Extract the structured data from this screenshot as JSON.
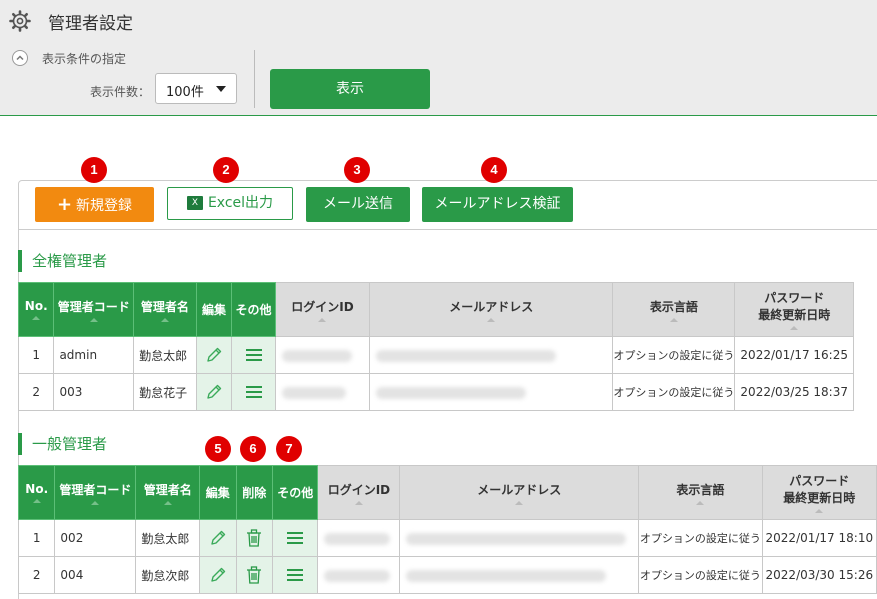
{
  "header": {
    "title": "管理者設定",
    "icon": "gear-icon"
  },
  "filter": {
    "section_label": "表示条件の指定",
    "count_label": "表示件数：",
    "count_value": "100件",
    "show_button": "表示"
  },
  "toolbar": {
    "new_label": "新規登録",
    "excel_label": "Excel出力",
    "mail_label": "メール送信",
    "verify_label": "メールアドレス検証"
  },
  "badges": [
    "1",
    "2",
    "3",
    "4",
    "5",
    "6",
    "7"
  ],
  "full_admins": {
    "title": "全権管理者",
    "headers": {
      "no": "No.",
      "code": "管理者コード",
      "name": "管理者名",
      "edit": "編集",
      "other": "その他",
      "login": "ログインID",
      "email": "メールアドレス",
      "lang": "表示言語",
      "pw1": "パスワード",
      "pw2": "最終更新日時"
    },
    "rows": [
      {
        "no": "1",
        "code": "admin",
        "name": "勤怠太郎",
        "lang": "オプションの設定に従う",
        "updated": "2022/01/17 16:25"
      },
      {
        "no": "2",
        "code": "003",
        "name": "勤怠花子",
        "lang": "オプションの設定に従う",
        "updated": "2022/03/25 18:37"
      }
    ]
  },
  "general_admins": {
    "title": "一般管理者",
    "headers": {
      "no": "No.",
      "code": "管理者コード",
      "name": "管理者名",
      "edit": "編集",
      "delete": "削除",
      "other": "その他",
      "login": "ログインID",
      "email": "メールアドレス",
      "lang": "表示言語",
      "pw1": "パスワード",
      "pw2": "最終更新日時"
    },
    "rows": [
      {
        "no": "1",
        "code": "002",
        "name": "勤怠太郎",
        "lang": "オプションの設定に従う",
        "updated": "2022/01/17 18:10"
      },
      {
        "no": "2",
        "code": "004",
        "name": "勤怠次郎",
        "lang": "オプションの設定に従う",
        "updated": "2022/03/30 15:26"
      }
    ]
  },
  "colors": {
    "green": "#2a9a48",
    "orange": "#f28a10",
    "badge_red": "#e00000",
    "action_cell": "#e4f3e8"
  }
}
